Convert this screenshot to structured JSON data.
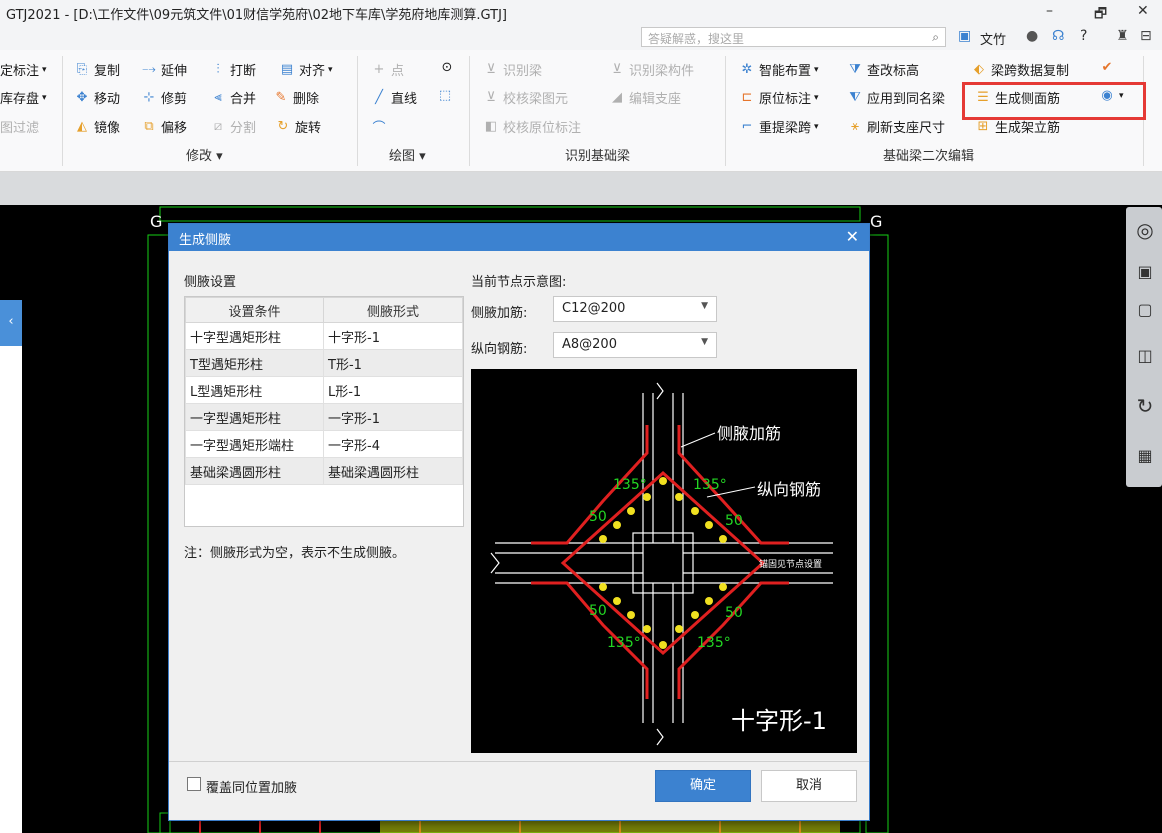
{
  "window": {
    "title": "GTJ2021 - [D:\\工作文件\\09元筑文件\\01财信学苑府\\02地下车库\\学苑府地库测算.GTJ]",
    "min": "–",
    "restore": "🗗",
    "close": "✕"
  },
  "topbar": {
    "search_placeholder": "答疑解惑，搜这里",
    "user": "文竹",
    "help": "?"
  },
  "ribbon": {
    "col0": [
      "定标注",
      "库存盘",
      "图过滤"
    ],
    "modify": {
      "items": [
        "复制",
        "延伸",
        "打断",
        "对齐",
        "移动",
        "修剪",
        "合并",
        "删除",
        "镜像",
        "偏移",
        "分割",
        "旋转"
      ],
      "group": "修改"
    },
    "draw": {
      "items": [
        "点",
        "直线"
      ],
      "group": "绘图"
    },
    "identify": {
      "items": [
        "识别梁",
        "识别梁构件",
        "校核梁图元",
        "编辑支座",
        "校核原位标注"
      ],
      "group": "识别基础梁"
    },
    "secondary": {
      "items": [
        "智能布置",
        "查改标高",
        "梁跨数据复制",
        "原位标注",
        "应用到同名梁",
        "生成侧面筋",
        "重提梁跨",
        "刷新支座尺寸",
        "生成架立筋"
      ],
      "group": "基础梁二次编辑"
    },
    "accent": "#e53935"
  },
  "dialog": {
    "title": "生成侧腋",
    "settings_title": "侧腋设置",
    "table": {
      "headers": [
        "设置条件",
        "侧腋形式"
      ],
      "rows": [
        [
          "十字型遇矩形柱",
          "十字形-1"
        ],
        [
          "T型遇矩形柱",
          "T形-1"
        ],
        [
          "L型遇矩形柱",
          "L形-1"
        ],
        [
          "一字型遇矩形柱",
          "一字形-1"
        ],
        [
          "一字型遇矩形端柱",
          "一字形-4"
        ],
        [
          "基础梁遇圆形柱",
          "基础梁遇圆形柱"
        ]
      ]
    },
    "note": "注：侧腋形式为空，表示不生成侧腋。",
    "diagram_title": "当前节点示意图:",
    "haunch_label": "侧腋加筋:",
    "haunch_value": "C12@200",
    "long_label": "纵向钢筋:",
    "long_value": "A8@200",
    "diagram": {
      "callout_haunch": "侧腋加筋",
      "callout_long": "纵向钢筋",
      "angle": "135°",
      "offset": "50",
      "anchor_note": "锚固见节点设置",
      "caption": "十字形-1"
    },
    "override_label": "覆盖同位置加腋",
    "ok": "确定",
    "cancel": "取消"
  }
}
